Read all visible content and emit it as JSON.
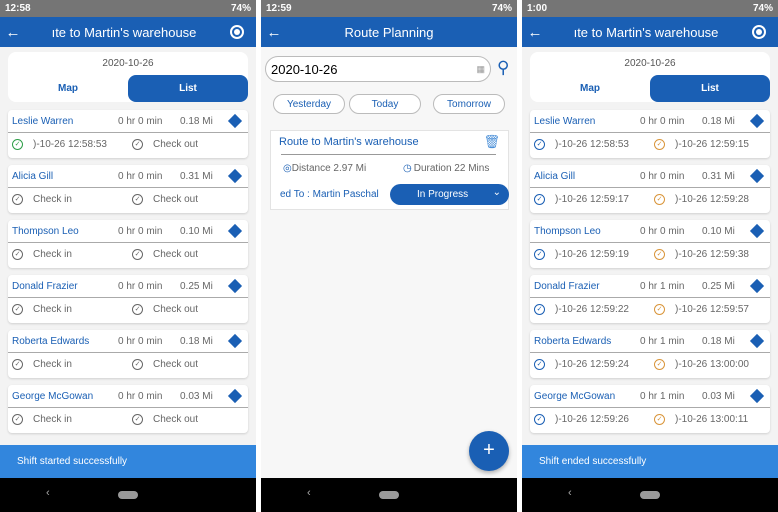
{
  "colors": {
    "primary": "#1a5fb4",
    "snackbar": "#3286dd",
    "checkin_done": "#2e9e48",
    "checkout_done": "#d9953a",
    "status_bar": "#757575"
  },
  "screens": [
    {
      "status_time": "12:58",
      "battery": "74%",
      "title": "ıte to Martin's warehouse",
      "date": "2020-10-26",
      "tabs": [
        "Map",
        "List"
      ],
      "snackbar": "Shift started successfully",
      "items": [
        {
          "name": "Leslie Warren",
          "duration": "0 hr 0 min",
          "distance": "0.18 Mi",
          "checkin": ")-10-26 12:58:53",
          "checkin_state": "done-green",
          "checkout": "Check out",
          "checkout_state": "pending"
        },
        {
          "name": "Alicia Gill",
          "duration": "0 hr 0 min",
          "distance": "0.31 Mi",
          "checkin": "Check in",
          "checkin_state": "pending",
          "checkout": "Check out",
          "checkout_state": "pending"
        },
        {
          "name": "Thompson Leo",
          "duration": "0 hr 0 min",
          "distance": "0.10 Mi",
          "checkin": "Check in",
          "checkin_state": "pending",
          "checkout": "Check out",
          "checkout_state": "pending"
        },
        {
          "name": "Donald Frazier",
          "duration": "0 hr 0 min",
          "distance": "0.25 Mi",
          "checkin": "Check in",
          "checkin_state": "pending",
          "checkout": "Check out",
          "checkout_state": "pending"
        },
        {
          "name": "Roberta Edwards",
          "duration": "0 hr 0 min",
          "distance": "0.18 Mi",
          "checkin": "Check in",
          "checkin_state": "pending",
          "checkout": "Check out",
          "checkout_state": "pending"
        },
        {
          "name": "George McGowan",
          "duration": "0 hr 0 min",
          "distance": "0.03 Mi",
          "checkin": "Check in",
          "checkin_state": "pending",
          "checkout": "Check out",
          "checkout_state": "pending"
        }
      ]
    },
    {
      "status_time": "12:59",
      "battery": "74%",
      "title": "Route Planning",
      "date_value": "2020-10-26",
      "quick": [
        "Yesterday",
        "Today",
        "Tomorrow"
      ],
      "route": {
        "name": "Route to Martin's warehouse",
        "distance": "Distance 2.97 Mi",
        "duration": "Duration 22 Mins",
        "assigned": "ed To : Martin Paschal",
        "status": "In Progress"
      },
      "fab": "+"
    },
    {
      "status_time": "1:00",
      "battery": "74%",
      "title": "ıte to Martin's warehouse",
      "date": "2020-10-26",
      "tabs": [
        "Map",
        "List"
      ],
      "snackbar": "Shift ended successfully",
      "items": [
        {
          "name": "Leslie Warren",
          "duration": "0 hr 0 min",
          "distance": "0.18 Mi",
          "checkin": ")-10-26 12:58:53",
          "checkin_state": "done-blue",
          "checkout": ")-10-26 12:59:15",
          "checkout_state": "done-orange"
        },
        {
          "name": "Alicia Gill",
          "duration": "0 hr 0 min",
          "distance": "0.31 Mi",
          "checkin": ")-10-26 12:59:17",
          "checkin_state": "done-blue",
          "checkout": ")-10-26 12:59:28",
          "checkout_state": "done-orange"
        },
        {
          "name": "Thompson Leo",
          "duration": "0 hr 0 min",
          "distance": "0.10 Mi",
          "checkin": ")-10-26 12:59:19",
          "checkin_state": "done-blue",
          "checkout": ")-10-26 12:59:38",
          "checkout_state": "done-orange"
        },
        {
          "name": "Donald Frazier",
          "duration": "0 hr 1 min",
          "distance": "0.25 Mi",
          "checkin": ")-10-26 12:59:22",
          "checkin_state": "done-blue",
          "checkout": ")-10-26 12:59:57",
          "checkout_state": "done-orange"
        },
        {
          "name": "Roberta Edwards",
          "duration": "0 hr 1 min",
          "distance": "0.18 Mi",
          "checkin": ")-10-26 12:59:24",
          "checkin_state": "done-blue",
          "checkout": ")-10-26 13:00:00",
          "checkout_state": "done-orange"
        },
        {
          "name": "George McGowan",
          "duration": "0 hr 1 min",
          "distance": "0.03 Mi",
          "checkin": ")-10-26 12:59:26",
          "checkin_state": "done-blue",
          "checkout": ")-10-26 13:00:11",
          "checkout_state": "done-orange"
        }
      ]
    }
  ]
}
